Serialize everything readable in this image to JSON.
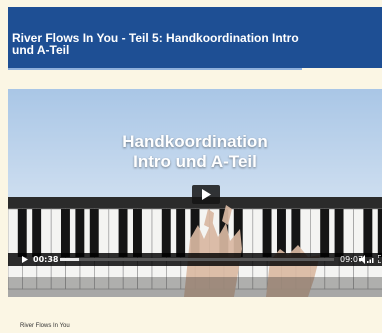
{
  "header": {
    "title": "River Flows In You - Teil 5: Handkoordination Intro und A-Teil"
  },
  "video": {
    "title_line1": "Handkoordination",
    "title_line2": "Intro und A-Teil",
    "current_time": "00:38",
    "duration": "09:07",
    "progress_fraction": 0.069,
    "icons": {
      "play": "play-icon",
      "volume": "volume-icon",
      "fullscreen": "fullscreen-icon"
    }
  },
  "caption": "River Flows In You",
  "colors": {
    "header_bg": "#1e4f94",
    "page_bg": "#fbf6e4",
    "header_underline": "#8fb0dc"
  }
}
